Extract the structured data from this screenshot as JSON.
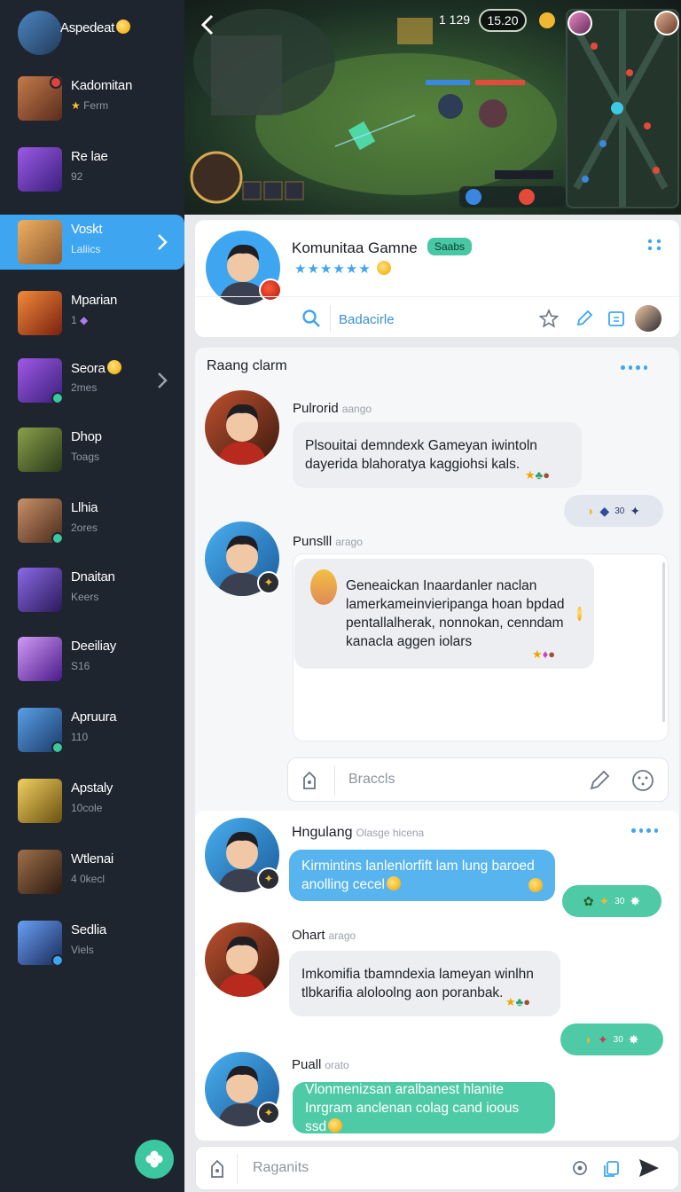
{
  "sidebar": {
    "items": [
      {
        "title": "Aspedeat",
        "sub": "",
        "color": "#3a6b9a"
      },
      {
        "title": "Kadomitan",
        "sub": "Ferm",
        "color": "#a0562f"
      },
      {
        "title": "Re lae",
        "sub": "92",
        "color": "#6a3bb8"
      },
      {
        "title": "Voskt",
        "sub": "Laliics",
        "color": "#8a5a32"
      },
      {
        "title": "Mparian",
        "sub": "1",
        "color": "#d2561f"
      },
      {
        "title": "Seora",
        "sub": "2mes",
        "color": "#7b33b9"
      },
      {
        "title": "Dhop",
        "sub": "Toags",
        "color": "#55692e"
      },
      {
        "title": "Llhia",
        "sub": "2ores",
        "color": "#8a5b38"
      },
      {
        "title": "Dnaitan",
        "sub": "Keers",
        "color": "#5e38a6"
      },
      {
        "title": "Deeiliay",
        "sub": "S16",
        "color": "#8b3ac9"
      },
      {
        "title": "Apruura",
        "sub": "110",
        "color": "#2f6fa5"
      },
      {
        "title": "Apstaly",
        "sub": "10cole",
        "color": "#c9a12a"
      },
      {
        "title": "Wtlenai",
        "sub": "4 0kecl",
        "color": "#5b3a2a"
      },
      {
        "title": "Sedlia",
        "sub": "Viels",
        "color": "#2b4c7e"
      }
    ]
  },
  "game": {
    "score": "1 129",
    "timer": "15.20"
  },
  "profile": {
    "name": "Komunitaa Gamne",
    "badge": "Saabs",
    "stars": "★★★★★★",
    "search_placeholder": "Badacirle"
  },
  "chat1": {
    "title": "Raang clarm",
    "messages": [
      {
        "name": "Pulrorid",
        "time": "aango",
        "text": "Plsouitai demndexk Gameyan iwintoln dayerida blahoratya kaggiohsi kals."
      },
      {
        "name": "Punslll",
        "time": "arago",
        "text": "Geneaickan Inaardanler naclan lamerkameinvieripanga hoan bpdad pentallalherak, nonnokan, cenndam kanacla aggen iolars"
      }
    ],
    "reaction_text": "30",
    "input_placeholder": "Braccls"
  },
  "chat2": {
    "title_name": "Hngulang",
    "title_time": "Olasge hicena",
    "messages": [
      {
        "text": "Kirmintins lanlenlorfift lam lung baroed anolling cecel"
      },
      {
        "name": "Ohart",
        "time": "arago",
        "text": "Imkomifia tbamndexia lameyan winlhn tlbkarifia aloloolng aon poranbak."
      },
      {
        "name": "Puall",
        "time": "orato",
        "text": "Vlonmenizsan aralbanest hlanite Inrgram anclenan colag cand ioous ssd"
      }
    ],
    "reaction_text": "30",
    "input_placeholder": "Raganits"
  },
  "colors": {
    "accent": "#3ea6f0",
    "teal": "#4fcaa6",
    "sidebar": "#1e252e"
  }
}
